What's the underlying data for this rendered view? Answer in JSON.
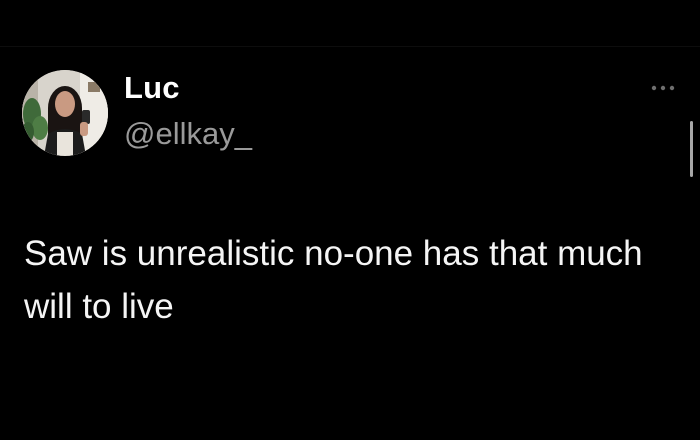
{
  "tweet": {
    "author": {
      "display_name": "Luc",
      "handle": "@ellkay_",
      "avatar_icon": "profile-photo"
    },
    "text": "Saw is unrealistic no-one has that much will to live",
    "more_icon": "more-options-icon"
  },
  "colors": {
    "background": "#000000",
    "primary_text": "#ffffff",
    "secondary_text": "#9a9a9a",
    "icon_muted": "#6e6e6e"
  }
}
